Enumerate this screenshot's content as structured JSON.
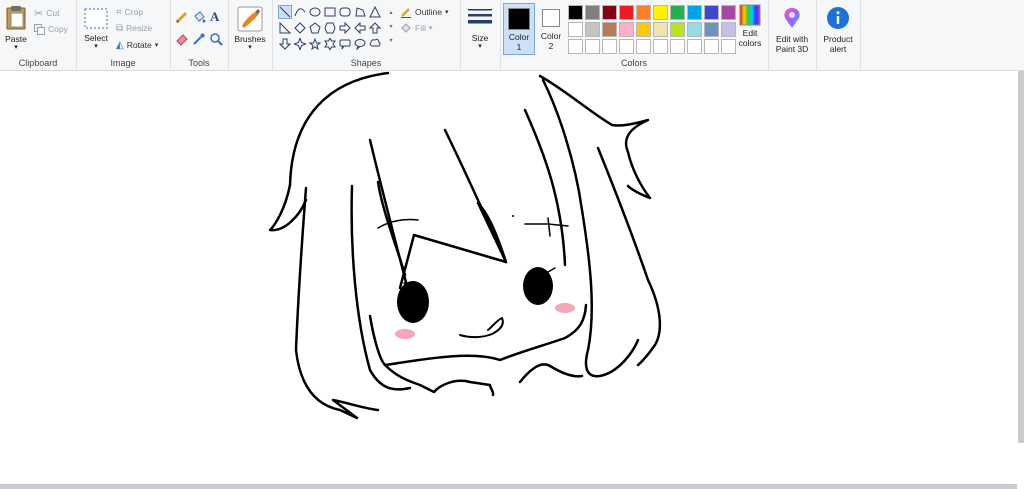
{
  "clipboard": {
    "group_label": "Clipboard",
    "paste": "Paste",
    "cut": "Cut",
    "copy": "Copy"
  },
  "image": {
    "group_label": "Image",
    "select": "Select",
    "crop": "Crop",
    "resize": "Resize",
    "rotate": "Rotate"
  },
  "tools": {
    "group_label": "Tools"
  },
  "brushes": {
    "label": "Brushes"
  },
  "shapes": {
    "group_label": "Shapes",
    "outline": "Outline",
    "fill": "Fill"
  },
  "size": {
    "label": "Size"
  },
  "colors": {
    "group_label": "Colors",
    "color1": "Color 1",
    "color2": "Color 2",
    "color1_value": "#000000",
    "color2_value": "#ffffff",
    "edit_colors": "Edit colors",
    "palette_row1": [
      "#000000",
      "#7f7f7f",
      "#880015",
      "#ed1c24",
      "#ff7f27",
      "#fff200",
      "#22b14c",
      "#00a2e8",
      "#3f48cc",
      "#a349a4"
    ],
    "palette_row2": [
      "#ffffff",
      "#c3c3c3",
      "#b97a57",
      "#ffaec9",
      "#ffc90e",
      "#efe4b0",
      "#b5e61d",
      "#99d9ea",
      "#7092be",
      "#c8bfe7"
    ],
    "palette_row3": [
      "#ffffff",
      "#ffffff",
      "#ffffff",
      "#ffffff",
      "#ffffff",
      "#ffffff",
      "#ffffff",
      "#ffffff",
      "#ffffff",
      "#ffffff"
    ]
  },
  "paint3d": {
    "label": "Edit with Paint 3D"
  },
  "product_alert": {
    "label": "Product alert"
  }
}
